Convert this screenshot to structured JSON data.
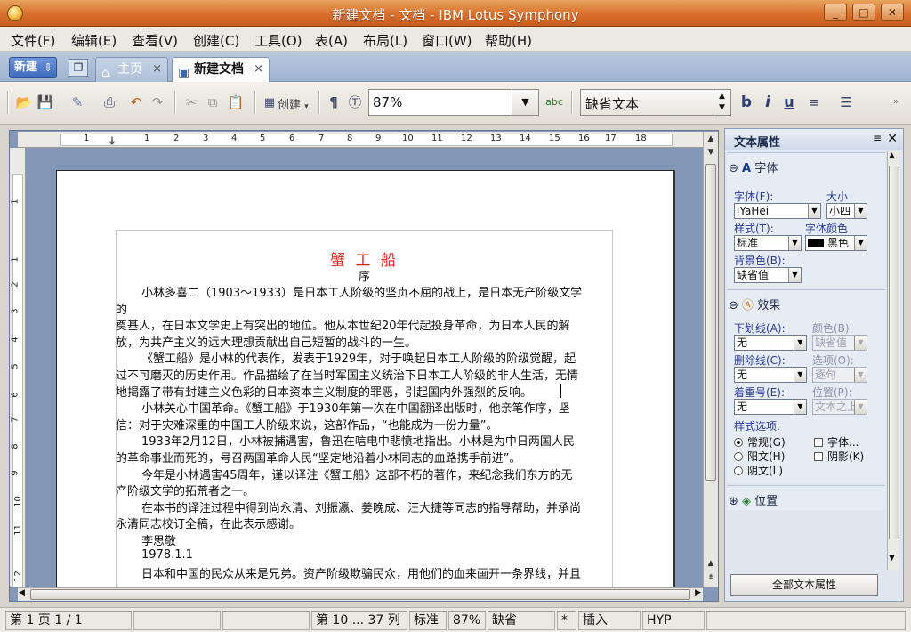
{
  "window": {
    "title": "新建文档 - 文档 - IBM Lotus Symphony",
    "min_glyph": "_",
    "max_glyph": "□",
    "close_glyph": "✕"
  },
  "menu": [
    "文件(F)",
    "编辑(E)",
    "查看(V)",
    "创建(C)",
    "工具(O)",
    "表(A)",
    "布局(L)",
    "窗口(W)",
    "帮助(H)"
  ],
  "tabs": {
    "new_label": "新建",
    "home_label": "主页",
    "doc_label": "新建文档",
    "close_glyph": "×"
  },
  "toolbar": {
    "create_label": "创建",
    "zoom_value": "87%",
    "paragraph_style": "缺省文本",
    "bold": "b",
    "italic": "i",
    "underline": "u"
  },
  "ruler": {
    "h_numbers": [
      "1",
      "1",
      "2",
      "3",
      "4",
      "5",
      "6",
      "7",
      "8",
      "9",
      "10",
      "11",
      "12",
      "13",
      "14",
      "15",
      "16",
      "17",
      "18"
    ],
    "v_numbers": [
      "1",
      "1",
      "2",
      "3",
      "4",
      "5",
      "6",
      "7",
      "8",
      "9",
      "10",
      "11",
      "12"
    ]
  },
  "document": {
    "title": "蟹 工 船",
    "subtitle": "序",
    "lines": [
      {
        "text": "小林多喜二（1903～1933）是日本工人阶级的坚贞不屈的战上，是日本无产阶级文学",
        "indent": true
      },
      {
        "text": "的",
        "indent": false
      },
      {
        "text": "奠基人，在日本文学史上有突出的地位。他从本世纪20年代起投身革命，为日本人民的解",
        "indent": false
      },
      {
        "text": "放，为共产主义的远大理想贡献出自己短暂的战斗的一生。",
        "indent": false
      },
      {
        "text": "《蟹工船》是小林的代表作，发表于1929年，对于唤起日本工人阶级的阶级觉醒，起",
        "indent": true
      },
      {
        "text": "过不可磨灭的历史作用。作品描绘了在当时军国主义统治下日本工人阶级的非人生活，无情",
        "indent": false
      },
      {
        "text": "地揭露了带有封建主义色彩的日本资本主义制度的罪恶，引起国内外强烈的反响。",
        "indent": false
      },
      {
        "text": "小林关心中国革命。《蟹工船》于1930年第一次在中国翻译出版时，他亲笔作序，坚",
        "indent": true
      },
      {
        "text": "信：对于灾难深重的中国工人阶级来说，这部作品，“也能成为一份力量”。",
        "indent": false
      },
      {
        "text": "1933年2月12日，小林被捕遇害，鲁迅在唁电中悲愤地指出。小林是为中日两国人民",
        "indent": true
      },
      {
        "text": "的革命事业而死的，号召两国革命人民“坚定地沿着小林同志的血路携手前进”。",
        "indent": false
      },
      {
        "text": "今年是小林遇害45周年，谨以译注《蟹工船》这部不朽的著作，来纪念我们东方的无",
        "indent": true
      },
      {
        "text": "产阶级文学的拓荒者之一。",
        "indent": false
      },
      {
        "text": "在本书的译注过程中得到尚永清、刘振瀛、姜晚成、汪大捷等同志的指导帮助，并承尚",
        "indent": true
      },
      {
        "text": "永清同志校订全稿，在此表示感谢。",
        "indent": false
      },
      {
        "text": "李思敬",
        "indent": true
      },
      {
        "text": "1978.1.1",
        "indent": true
      },
      {
        "text": "日本和中国的民众从来是兄弟。资产阶级欺骗民众，用他们的血来画开一条界线，并且",
        "indent": true
      }
    ]
  },
  "panel": {
    "title": "文本属性",
    "font_section": "字体",
    "font_label": "字体(F):",
    "font_value": "iYaHei",
    "size_label": "大小",
    "size_value": "小四",
    "style_label": "样式(T):",
    "style_value": "标准",
    "color_label": "字体颜色",
    "color_value": "黑色",
    "bg_label": "背景色(B):",
    "bg_value": "缺省值",
    "effects_section": "效果",
    "underline_label": "下划线(A):",
    "underline_value": "无",
    "ucolor_label": "颜色(B):",
    "ucolor_value": "缺省值",
    "strike_label": "删除线(C):",
    "strike_value": "无",
    "option_label": "选项(O):",
    "option_value": "逐句",
    "emph_label": "着重号(E):",
    "emph_value": "无",
    "pos_label": "位置(P):",
    "pos_value": "文本之上",
    "styleopt_label": "样式选项:",
    "radio_normal": "常规(G)",
    "radio_emboss": "阳文(H)",
    "radio_engrave": "阴文(L)",
    "chk_outline": "字体...",
    "chk_shadow": "阴影(K)",
    "position_section": "位置",
    "all_props_button": "全部文本属性"
  },
  "status": {
    "page": "第 1 页  1 / 1",
    "cursor": "第 10 ... 37 列",
    "style": "标准",
    "zoom": "87%",
    "lang": "缺省",
    "modified": "*",
    "insert": "插入",
    "hyp": "HYP"
  },
  "colors": {
    "title_red": "#e0201c",
    "titlebar_orange": "#d86f2c",
    "doc_background": "#8397b6"
  }
}
